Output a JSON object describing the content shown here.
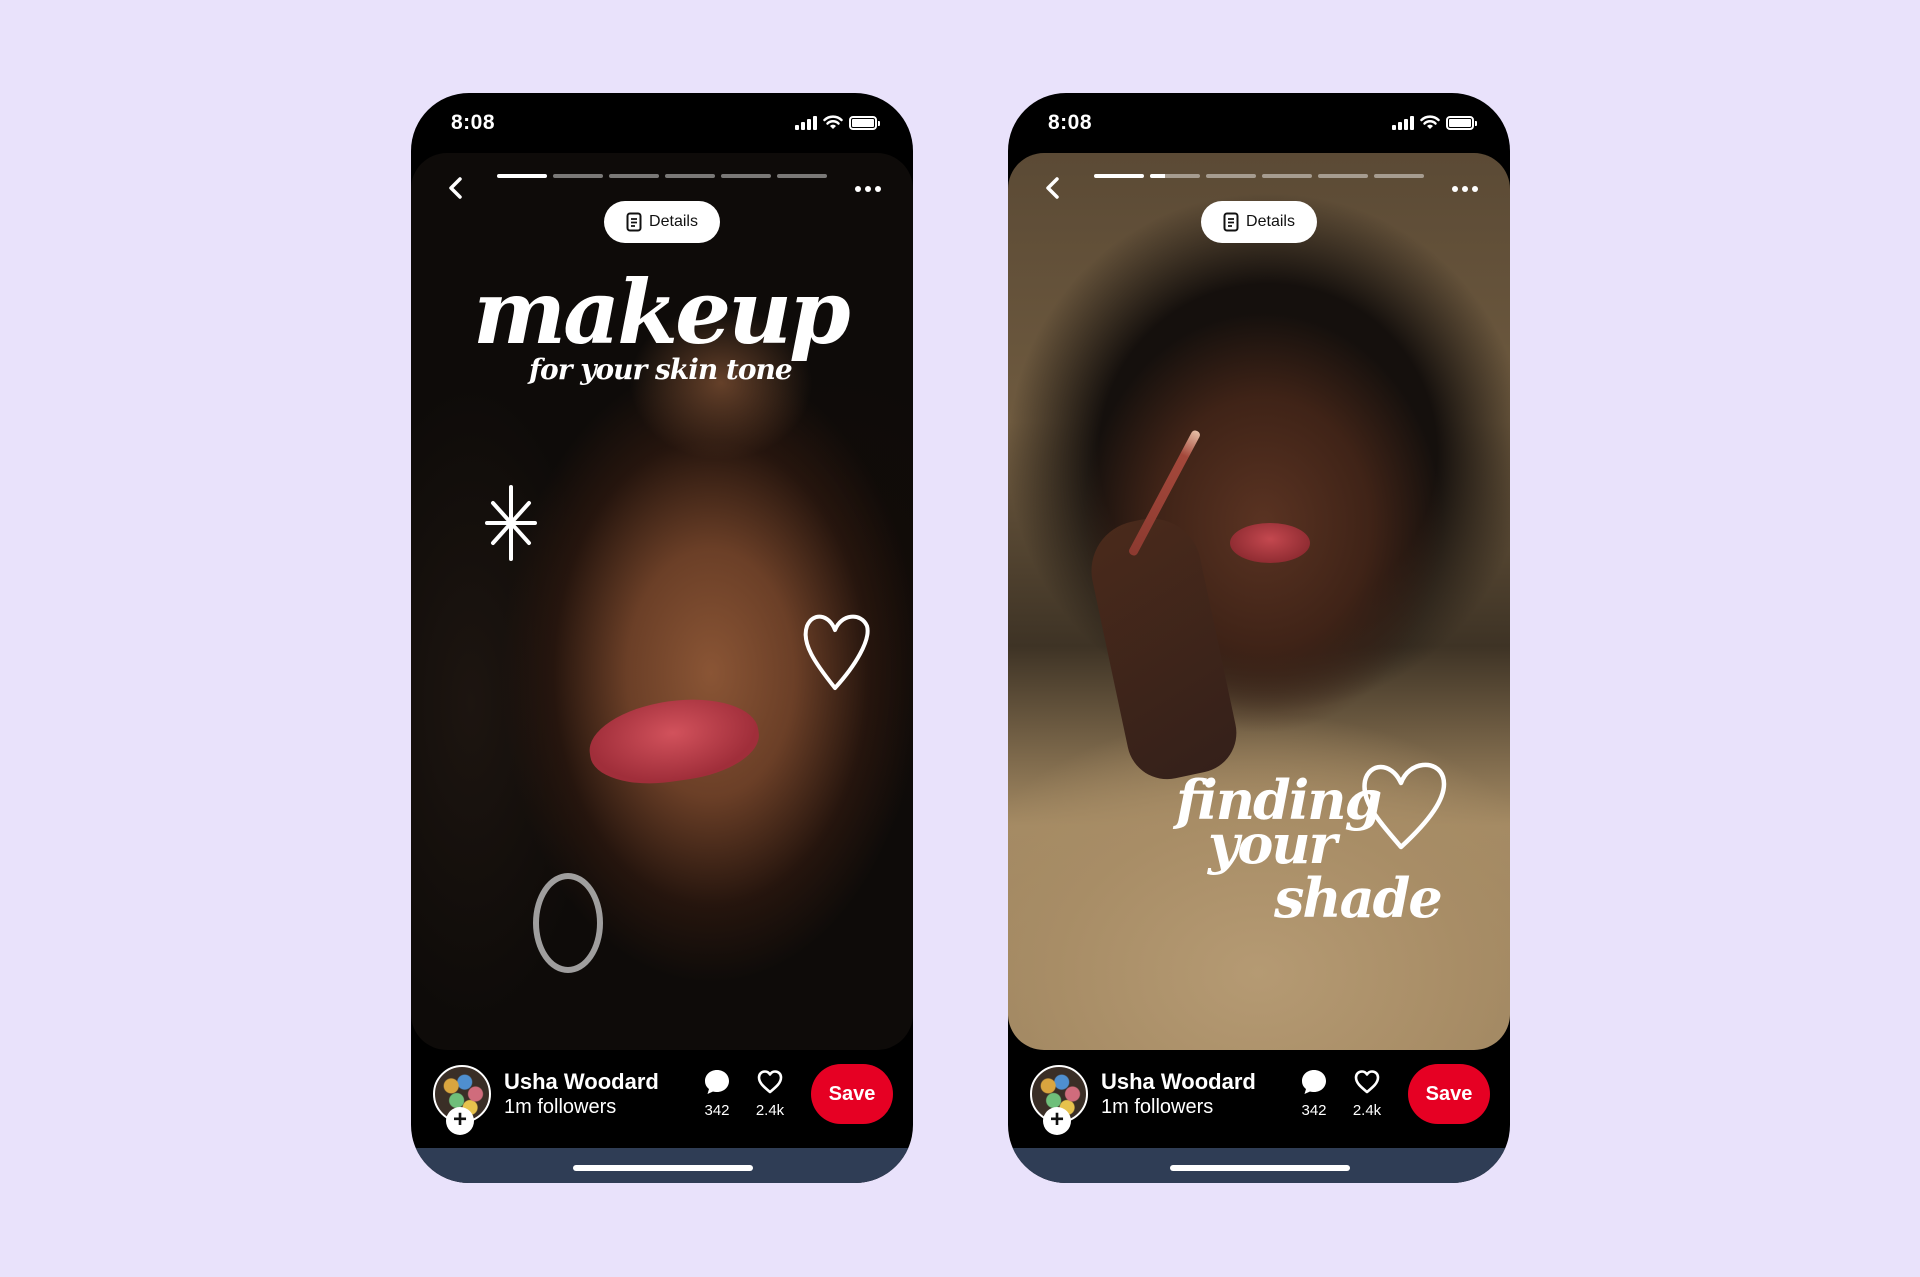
{
  "phones": [
    {
      "status_time": "8:08",
      "details_label": "Details",
      "progress": {
        "segments": 6,
        "active_index": 0,
        "active_fraction": 1.0
      },
      "headline_main": "makeup",
      "headline_sub": "for your skin tone",
      "author_name": "Usha Woodard",
      "followers": "1m followers",
      "comments_count": "342",
      "likes_count": "2.4k",
      "save_label": "Save"
    },
    {
      "status_time": "8:08",
      "details_label": "Details",
      "progress": {
        "segments": 6,
        "active_index": 1,
        "active_fraction": 0.3
      },
      "headline_lines": [
        "finding",
        "your",
        "shade"
      ],
      "author_name": "Usha Woodard",
      "followers": "1m followers",
      "comments_count": "342",
      "likes_count": "2.4k",
      "save_label": "Save"
    }
  ],
  "colors": {
    "background": "#e9e2fb",
    "save_button": "#e60023",
    "phone_frame": "#000000",
    "home_bar": "#2f3d55"
  },
  "icons": [
    "back-chevron-icon",
    "more-dots-icon",
    "document-icon",
    "comment-bubble-icon",
    "heart-icon",
    "plus-icon",
    "sparkle-icon",
    "signal-icon",
    "wifi-icon",
    "battery-icon"
  ]
}
